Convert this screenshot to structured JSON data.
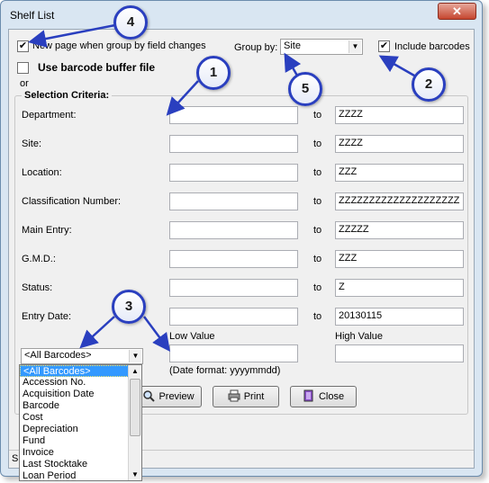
{
  "window": {
    "title": "Shelf List",
    "close_glyph": "✕"
  },
  "options": {
    "new_page_label": "New page when group by field changes",
    "new_page_checked": true,
    "barcode_buffer_label": "Use barcode buffer file",
    "barcode_buffer_checked": false,
    "or_label": "or",
    "group_by_label": "Group by:",
    "group_by_value": "Site",
    "include_barcodes_label": "Include barcodes",
    "include_barcodes_checked": true
  },
  "criteria": {
    "title": "Selection Criteria:",
    "to_label": "to",
    "rows": [
      {
        "label": "Department:",
        "low": "",
        "high": "ZZZZ"
      },
      {
        "label": "Site:",
        "low": "",
        "high": "ZZZZ"
      },
      {
        "label": "Location:",
        "low": "",
        "high": "ZZZ"
      },
      {
        "label": "Classification Number:",
        "low": "",
        "high": "ZZZZZZZZZZZZZZZZZZZZ"
      },
      {
        "label": "Main Entry:",
        "low": "",
        "high": "ZZZZZ"
      },
      {
        "label": "G.M.D.:",
        "low": "",
        "high": "ZZZ"
      },
      {
        "label": "Status:",
        "low": "",
        "high": "Z"
      },
      {
        "label": "Entry Date:",
        "low": "",
        "high": "20130115"
      }
    ],
    "low_value_label": "Low Value",
    "high_value_label": "High Value",
    "date_format_label": "(Date format: yyyymmdd)",
    "extra_select_value": "<All Barcodes>"
  },
  "buttons": {
    "preview": "Preview",
    "print": "Print",
    "close": "Close"
  },
  "status": {
    "text": "S"
  },
  "dropdown": {
    "items": [
      "<All Barcodes>",
      "Accession No.",
      "Acquisition Date",
      "Barcode",
      "Cost",
      "Depreciation",
      "Fund",
      "Invoice",
      "Last Stocktake",
      "Loan Period"
    ],
    "selected_index": 0
  },
  "callouts": [
    "1",
    "2",
    "3",
    "4",
    "5"
  ],
  "colors": {
    "callout_border": "#2a3fbf",
    "selected": "#3399ff",
    "close_button": "#c6462f"
  }
}
